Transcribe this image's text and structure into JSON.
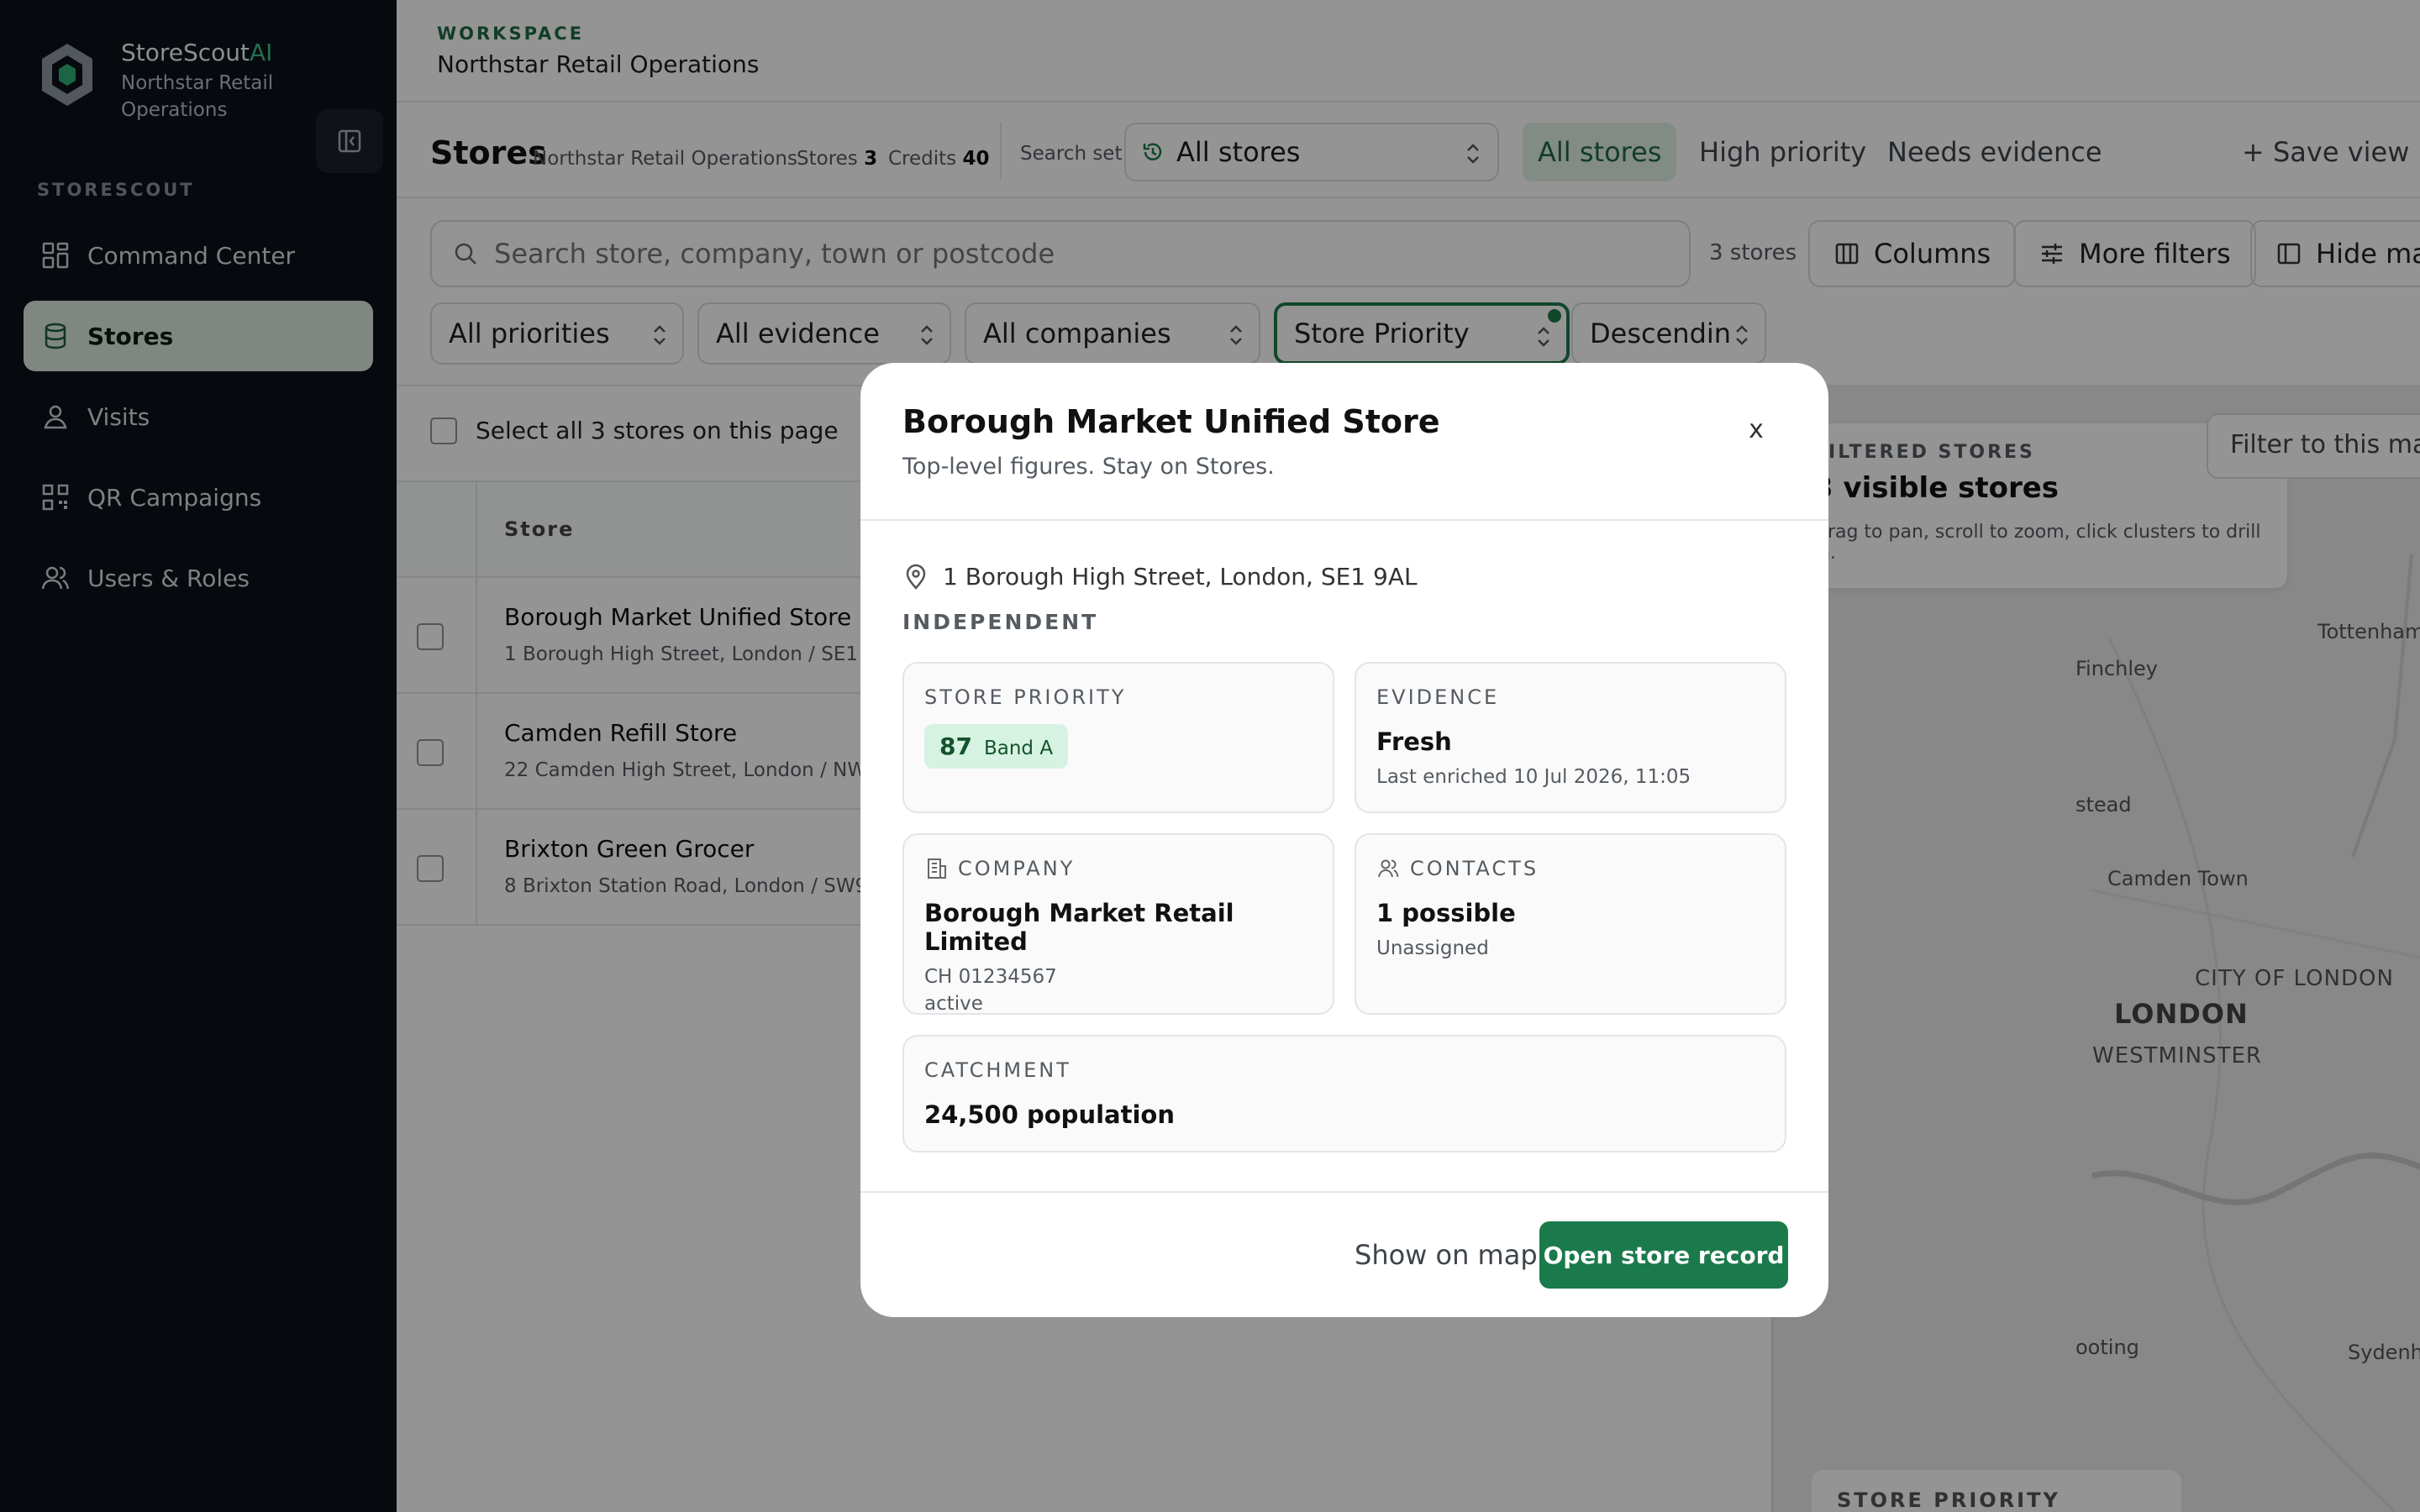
{
  "brand": {
    "name": "StoreScout",
    "name_suffix": "AI",
    "subtitle": "Northstar Retail Operations",
    "accent": "#3fbf87"
  },
  "sidebar": {
    "section_heading": "STORESCOUT",
    "items": [
      {
        "label": "Command Center",
        "icon": "grid-icon",
        "active": false
      },
      {
        "label": "Stores",
        "icon": "database-icon",
        "active": true
      },
      {
        "label": "Visits",
        "icon": "user-pin-icon",
        "active": false
      },
      {
        "label": "QR Campaigns",
        "icon": "qr-icon",
        "active": false
      },
      {
        "label": "Users & Roles",
        "icon": "users-icon",
        "active": false
      }
    ]
  },
  "workspace": {
    "label": "WORKSPACE",
    "name": "Northstar Retail Operations"
  },
  "topbar": {
    "title": "Stores",
    "org": "Northstar Retail Operations",
    "stores_label": "Stores",
    "stores_count": "3",
    "credits_label": "Credits",
    "credits_count": "40",
    "search_set_label": "Search set",
    "search_set_value": "All stores",
    "views": [
      "All stores",
      "High priority",
      "Needs evidence"
    ],
    "save_view": "+ Save view"
  },
  "toolbar": {
    "search_placeholder": "Search store, company, town or postcode",
    "count": "3 stores",
    "columns": "Columns",
    "more_filters": "More filters",
    "hide_map": "Hide map"
  },
  "filters": {
    "priority": "All priorities",
    "evidence": "All evidence",
    "companies": "All companies",
    "sort_by": "Store Priority",
    "sort_dir": "Descendin"
  },
  "list": {
    "select_all": "Select all 3 stores on this page",
    "column_store": "Store",
    "rows": [
      {
        "name": "Borough Market Unified Store",
        "addr": "1 Borough High Street, London / SE1 9AL"
      },
      {
        "name": "Camden Refill Store",
        "addr": "22 Camden High Street, London / NW1 8QP"
      },
      {
        "name": "Brixton Green Grocer",
        "addr": "8 Brixton Station Road, London / SW9 8PD"
      }
    ]
  },
  "map": {
    "filter_btn": "Filter to this map",
    "card_label": "FILTERED STORES",
    "card_value": "3 visible stores",
    "card_hint": "Drag to pan, scroll to zoom, click clusters to drill in.",
    "labels": [
      "Tottenham",
      "Finchley",
      "stead",
      "Camden Town",
      "CITY OF LONDON",
      "LONDON",
      "WESTMINSTER",
      "ooting",
      "Sydenh"
    ],
    "bottom_card": "STORE PRIORITY"
  },
  "modal": {
    "title": "Borough Market Unified Store",
    "subtitle": "Top-level figures. Stay on Stores.",
    "close": "x",
    "address": "1 Borough High Street, London, SE1 9AL",
    "type": "INDEPENDENT",
    "priority": {
      "label": "STORE PRIORITY",
      "score": "87",
      "band": "Band A"
    },
    "evidence": {
      "label": "EVIDENCE",
      "value": "Fresh",
      "sub": "Last enriched 10 Jul 2026, 11:05"
    },
    "company": {
      "label": "COMPANY",
      "value": "Borough Market Retail Limited",
      "number": "CH 01234567",
      "status": "active"
    },
    "contacts": {
      "label": "CONTACTS",
      "value": "1 possible",
      "sub": "Unassigned"
    },
    "catchment": {
      "label": "CATCHMENT",
      "value": "24,500 population"
    },
    "show_on_map": "Show on map",
    "open_record": "Open store record",
    "primary_color": "#1b7a4b"
  }
}
